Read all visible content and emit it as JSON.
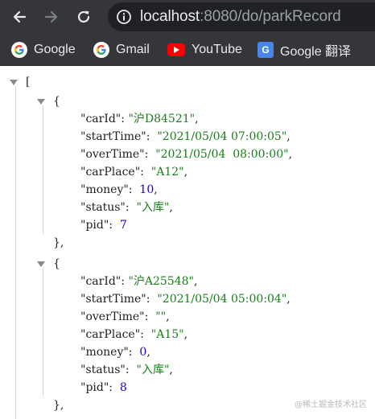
{
  "browser": {
    "url_host": "localhost",
    "url_rest": ":8080/do/parkRecord"
  },
  "bookmarks": [
    {
      "label": "Google",
      "icon": "google-icon"
    },
    {
      "label": "Gmail",
      "icon": "google-icon"
    },
    {
      "label": "YouTube",
      "icon": "youtube-icon"
    },
    {
      "label": "Google 翻译",
      "icon": "google-translate-icon"
    }
  ],
  "json": {
    "open_bracket": "[",
    "records": [
      {
        "carId": "\"沪D84521\"",
        "startTime": "\"2021/05/04 07:00:05\"",
        "overTime": "\"2021/05/04  08:00:00\"",
        "carPlace": "\"A12\"",
        "money": "10",
        "status": "\"入库\"",
        "pid": "7"
      },
      {
        "carId": "\"沪A25548\"",
        "startTime": "\"2021/05/04 05:00:04\"",
        "overTime": "\"\"",
        "carPlace": "\"A15\"",
        "money": "0",
        "status": "\"入库\"",
        "pid": "8"
      }
    ],
    "keys": {
      "carId": "\"carId\"",
      "startTime": "\"startTime\"",
      "overTime": "\"overTime\"",
      "carPlace": "\"carPlace\"",
      "money": "\"money\"",
      "status": "\"status\"",
      "pid": "\"pid\""
    }
  },
  "watermark": "@稀土掘金技术社区",
  "colors": {
    "toolbar": "#35363a",
    "omnibox": "#202124",
    "json_string": "#1a7f1a",
    "json_number": "#1c00cf"
  }
}
